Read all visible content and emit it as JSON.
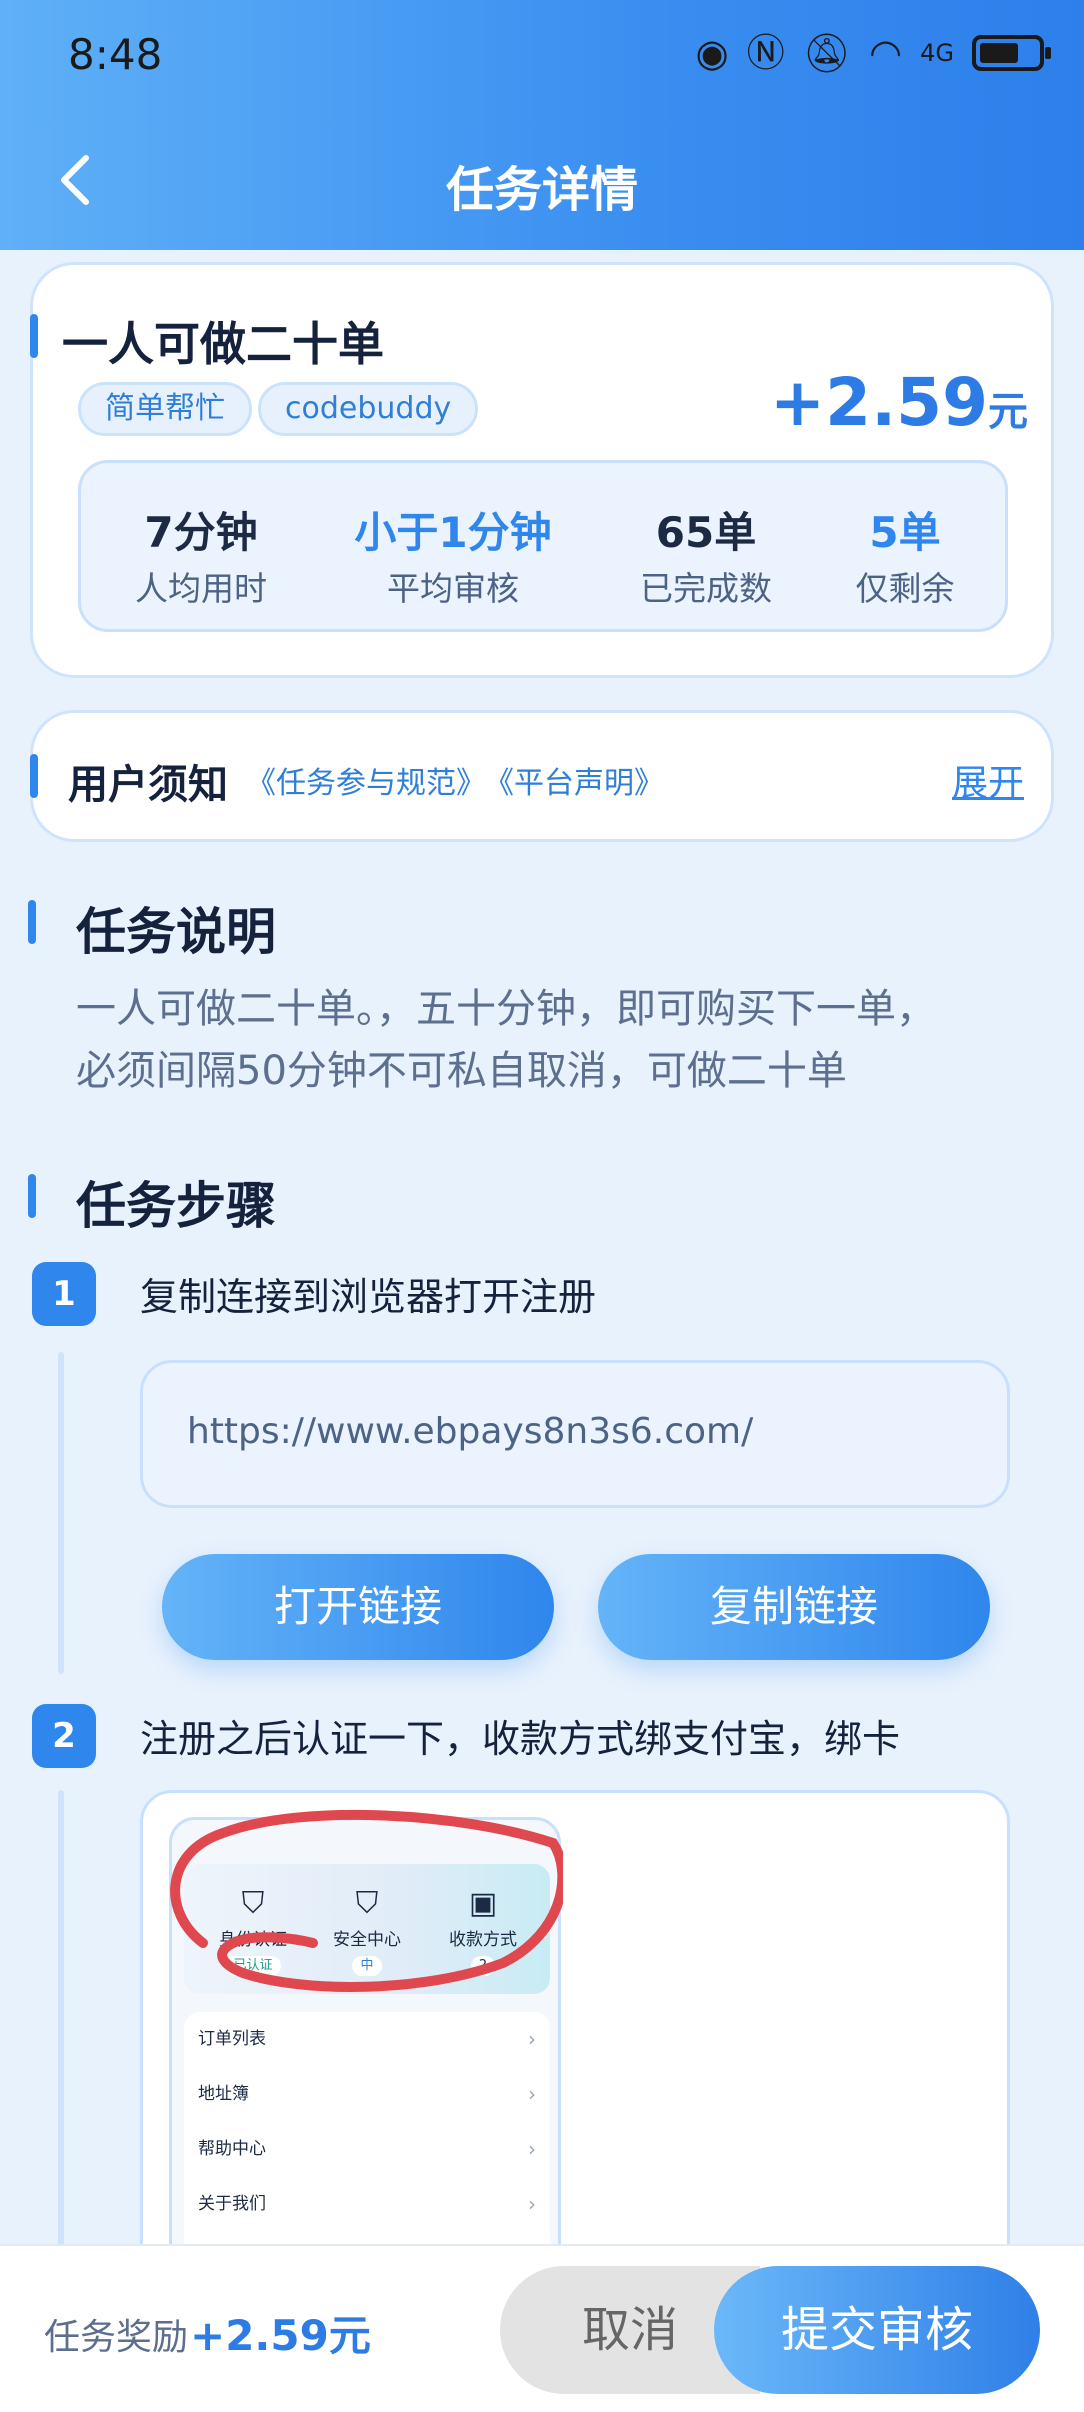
{
  "status_bar": {
    "time": "8:48",
    "network": "4G"
  },
  "header": {
    "title": "任务详情"
  },
  "task": {
    "name": "一人可做二十单",
    "tags": [
      "简单帮忙",
      "codebuddy"
    ],
    "reward_amount": "+2.59",
    "reward_unit": "元",
    "stats": [
      {
        "value": "7分钟",
        "label": "人均用时"
      },
      {
        "value": "小于1分钟",
        "label": "平均审核"
      },
      {
        "value": "65单",
        "label": "已完成数"
      },
      {
        "value": "5单",
        "label": "仅剩余"
      }
    ]
  },
  "notice": {
    "title": "用户须知",
    "links": [
      "《任务参与规范》",
      "《平台声明》"
    ],
    "expand_label": "展开"
  },
  "description": {
    "title": "任务说明",
    "lines": [
      "一人可做二十单。，五十分钟，即可购买下一单，",
      "必须间隔50分钟不可私自取消，可做二十单"
    ]
  },
  "steps": {
    "title": "任务步骤",
    "items": [
      {
        "num": "1",
        "text": "复制连接到浏览器打开注册"
      },
      {
        "num": "2",
        "text": "注册之后认证一下，收款方式绑支付宝，绑卡"
      }
    ],
    "url": "https://www.ebpays8n3s6.com/",
    "open_label": "打开链接",
    "copy_label": "复制链接",
    "screenshot": {
      "tiles": [
        {
          "label": "身份认证",
          "sub": "已认证"
        },
        {
          "label": "安全中心",
          "sub": "中"
        },
        {
          "label": "收款方式",
          "sub": "2"
        }
      ],
      "rows": [
        "订单列表",
        "地址簿",
        "帮助中心",
        "关于我们"
      ]
    }
  },
  "footer": {
    "reward_label": "任务奖励",
    "reward_value": "+2.59元",
    "cancel_label": "取消",
    "submit_label": "提交审核"
  }
}
